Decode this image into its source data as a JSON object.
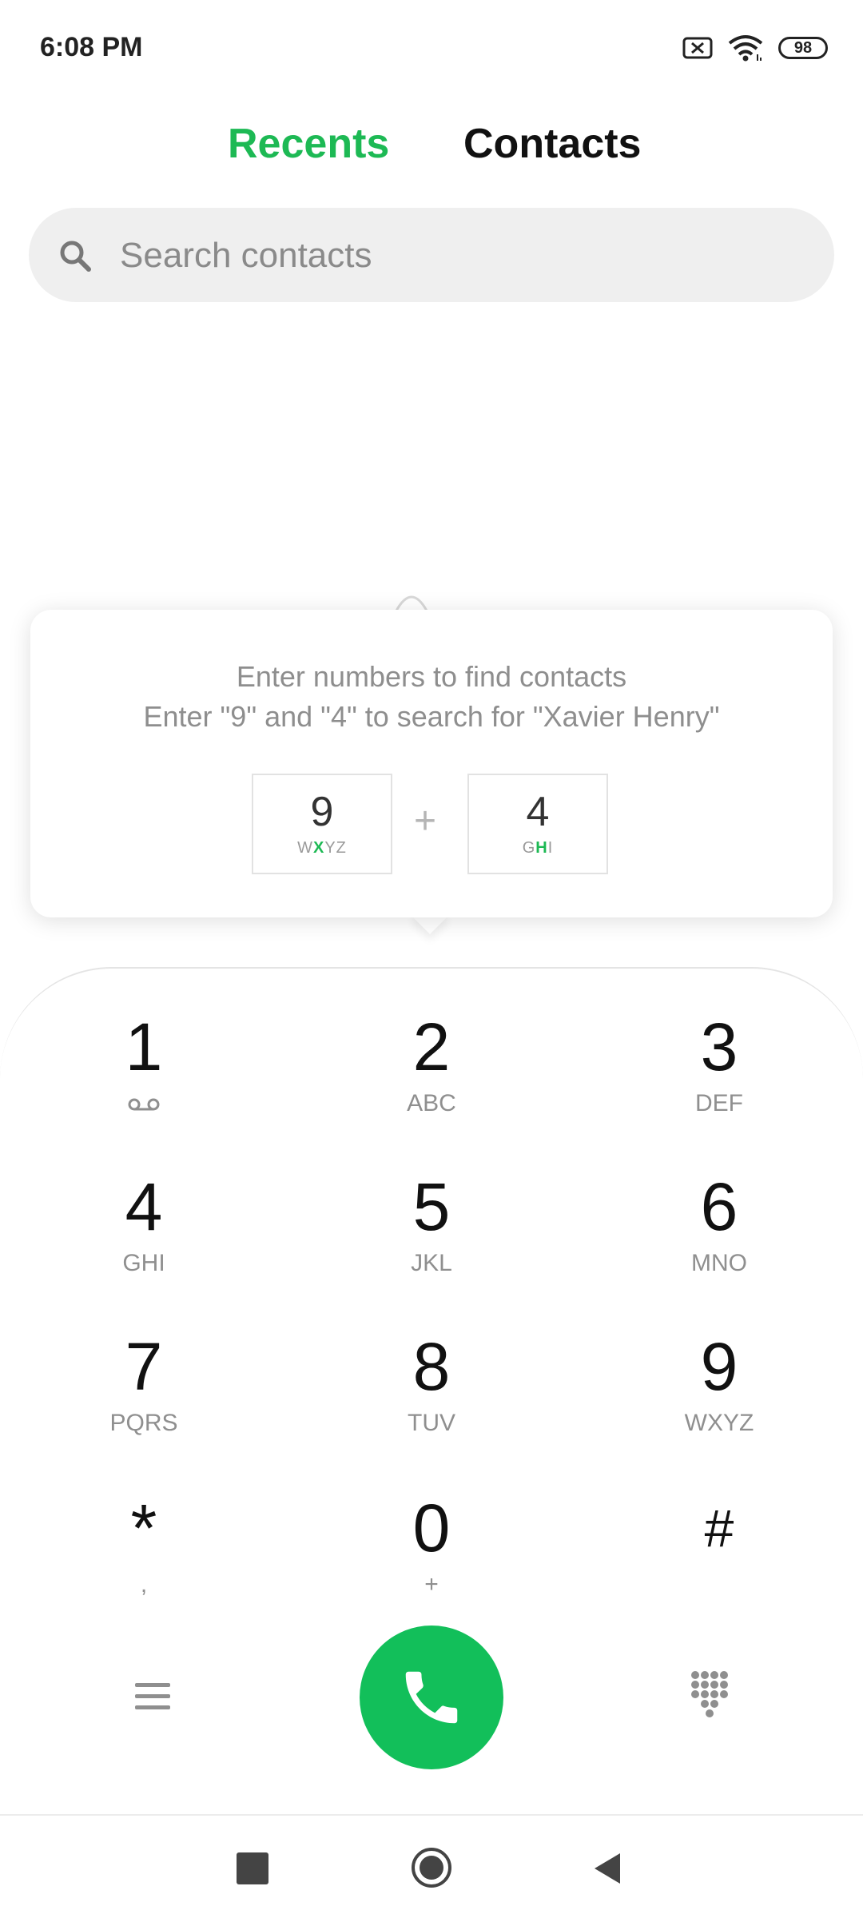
{
  "status_bar": {
    "time": "6:08 PM",
    "battery": "98",
    "icons": [
      "sim-off-icon",
      "wifi-icon",
      "battery-icon"
    ]
  },
  "tabs": [
    {
      "label": "Recents",
      "active": true
    },
    {
      "label": "Contacts",
      "active": false
    }
  ],
  "search": {
    "placeholder": "Search contacts"
  },
  "hint": {
    "line1": "Enter numbers to find contacts",
    "line2": "Enter \"9\" and \"4\" to search for \"Xavier Henry\"",
    "example_keys": [
      {
        "digit": "9",
        "letters_before": "W",
        "letter_highlight": "X",
        "letters_after": "YZ"
      },
      {
        "digit": "4",
        "letters_before": "G",
        "letter_highlight": "H",
        "letters_after": "I"
      }
    ],
    "plus": "+"
  },
  "dialpad": {
    "keys": [
      {
        "digit": "1",
        "sub": "",
        "sub_icon": "voicemail-icon"
      },
      {
        "digit": "2",
        "sub": "ABC"
      },
      {
        "digit": "3",
        "sub": "DEF"
      },
      {
        "digit": "4",
        "sub": "GHI"
      },
      {
        "digit": "5",
        "sub": "JKL"
      },
      {
        "digit": "6",
        "sub": "MNO"
      },
      {
        "digit": "7",
        "sub": "PQRS"
      },
      {
        "digit": "8",
        "sub": "TUV"
      },
      {
        "digit": "9",
        "sub": "WXYZ"
      },
      {
        "digit": "*",
        "sub": ","
      },
      {
        "digit": "0",
        "sub": "+"
      },
      {
        "digit": "#",
        "sub": ""
      }
    ]
  },
  "actions": {
    "menu_icon": "menu-icon",
    "call_icon": "phone-icon",
    "dialpad_icon": "dialpad-grid-icon"
  },
  "colors": {
    "accent": "#1db954",
    "call_button": "#12bf5a",
    "search_bg": "#efefef"
  }
}
